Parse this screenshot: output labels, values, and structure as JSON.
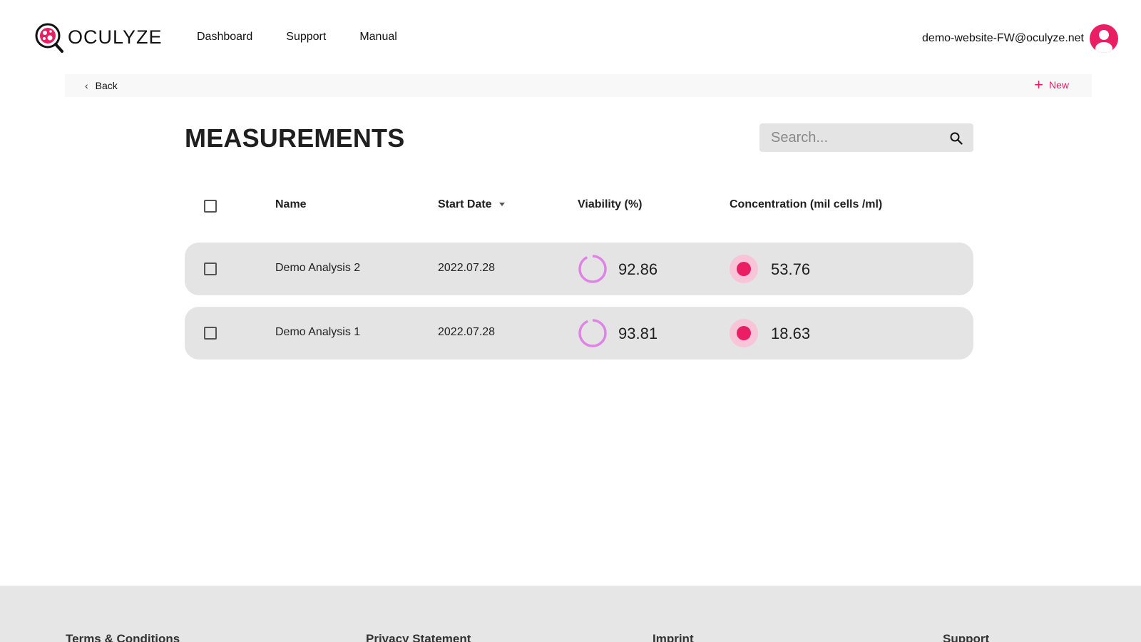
{
  "header": {
    "brand": "OCULYZE",
    "nav": [
      "Dashboard",
      "Support",
      "Manual"
    ],
    "user_email": "demo-website-FW@oculyze.net"
  },
  "toolbar": {
    "back_label": "Back",
    "new_label": "New"
  },
  "main": {
    "title": "MEASUREMENTS",
    "search_placeholder": "Search..."
  },
  "table": {
    "columns": [
      "Name",
      "Start Date",
      "Viability (%)",
      "Concentration (mil cells /ml)"
    ],
    "rows": [
      {
        "name": "Demo Analysis 2",
        "start_date": "2022.07.28",
        "viability": "92.86",
        "concentration": "53.76"
      },
      {
        "name": "Demo Analysis 1",
        "start_date": "2022.07.28",
        "viability": "93.81",
        "concentration": "18.63"
      }
    ]
  },
  "footer": {
    "links": [
      "Terms & Conditions",
      "Privacy Statement",
      "Imprint",
      "Support"
    ]
  },
  "colors": {
    "accent": "#e91e63",
    "viability_ring": "#e083e6",
    "row_bg": "#e4e4e4",
    "footer_bg": "#e6e6e6"
  },
  "icons": [
    "logo-icon",
    "avatar-icon",
    "chevron-left-icon",
    "plus-icon",
    "search-icon",
    "sort-down-icon",
    "viability-ring-icon",
    "concentration-dot-icon"
  ]
}
